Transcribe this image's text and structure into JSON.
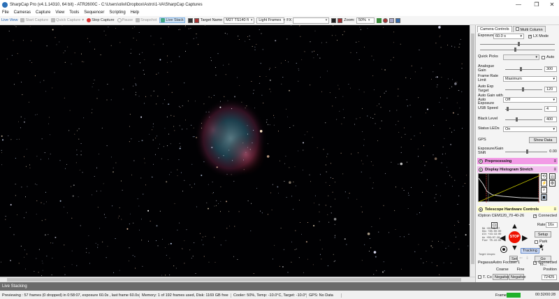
{
  "window": {
    "title": "SharpCap Pro (v4.1.14310, 64 bit) - ATR2600C - C:\\Users\\olivi\\Dropbox\\Astro\\1-VA\\SharpCap Captures",
    "minimize": "—",
    "maximize": "❐",
    "close": "✕"
  },
  "menu": [
    "File",
    "Cameras",
    "Capture",
    "View",
    "Tools",
    "Sequencer",
    "Scripting",
    "Help"
  ],
  "toolbar": {
    "live_view": "Live View",
    "start_capture": "Start Capture",
    "quick_capture": "Quick Capture",
    "stop_capture": "Stop Capture",
    "pause": "Pause",
    "snapshot": "Snapshot",
    "live_stack": "Live Stack",
    "target_label": "Target Name",
    "target_value": "M27 TS140 fi",
    "frame_type": "Light Frames",
    "fx_label": "FX",
    "zoom_label": "Zoom:",
    "zoom_value": "50%"
  },
  "panel": {
    "tab_controls": "Camera Controls",
    "tab_multi": "Multi Column",
    "exposure_label": "Exposure",
    "exposure_value": "60.0 s",
    "lx_mode": "LX Mode",
    "quick_picks": "Quick Picks",
    "auto": "Auto",
    "analogue_gain_label": "Analogue Gain",
    "analogue_gain_value": "300",
    "frame_rate_label": "Frame Rate Limit",
    "frame_rate_value": "Maximum",
    "auto_exp_label": "Auto Exp Target",
    "auto_exp_value": "120",
    "auto_gain_label": "Auto Gain with Auto Exposure",
    "auto_gain_value": "Off",
    "usb_speed_label": "USB Speed",
    "usb_speed_value": "4",
    "black_level_label": "Black Level",
    "black_level_value": "400",
    "status_leds_label": "Status LEDs",
    "status_leds_value": "On",
    "gps_label": "GPS",
    "show_data": "Show Data",
    "exp_gain_shift_label": "Exposure/Gain Shift",
    "exp_gain_shift_value": "0.00",
    "preprocessing": "Preprocessing",
    "histogram": "Display Histogram Stretch",
    "telescope": "Telescope Hardware Controls",
    "mount_name": "iOptron CEM120_70-40-26",
    "connected": "Connected",
    "rate_label": "Rate",
    "rate_value": "16x",
    "setup": "Setup",
    "park": "Park",
    "stop": "STOP",
    "tracking": "Tracking",
    "set": "Set",
    "goto": "Go To...",
    "focuser_name": "PegasusAstro Focuser 1",
    "coarse": "Coarse",
    "fine": "Fine",
    "position": "Position",
    "t_comp": "T. Co",
    "negative1": "Negative",
    "negative2": "Negative",
    "position_value": "72425",
    "coords": [
      "RA  +05:09:17",
      "Dec +85:00:00",
      "Alt +43:19:00",
      "Az  +09:07:28",
      "Pier TR-10:00"
    ],
    "target_small": "Target: Unspec"
  },
  "status": {
    "live_stacking": "Live Stacking",
    "previewing": "Previewing : 57 frames (0 dropped) in 0:58:07, exposure 60.0s , last frame 60.0s",
    "memory": "Memory: 1 of 192 frames used, Disk: 1169 GB free",
    "cooler": "Cooler: 50%, Temp: -10.0°C, Target: -10.0°",
    "gps": "GPS: No Data",
    "frame": "Frame:",
    "timer": "00:32/00:28"
  }
}
